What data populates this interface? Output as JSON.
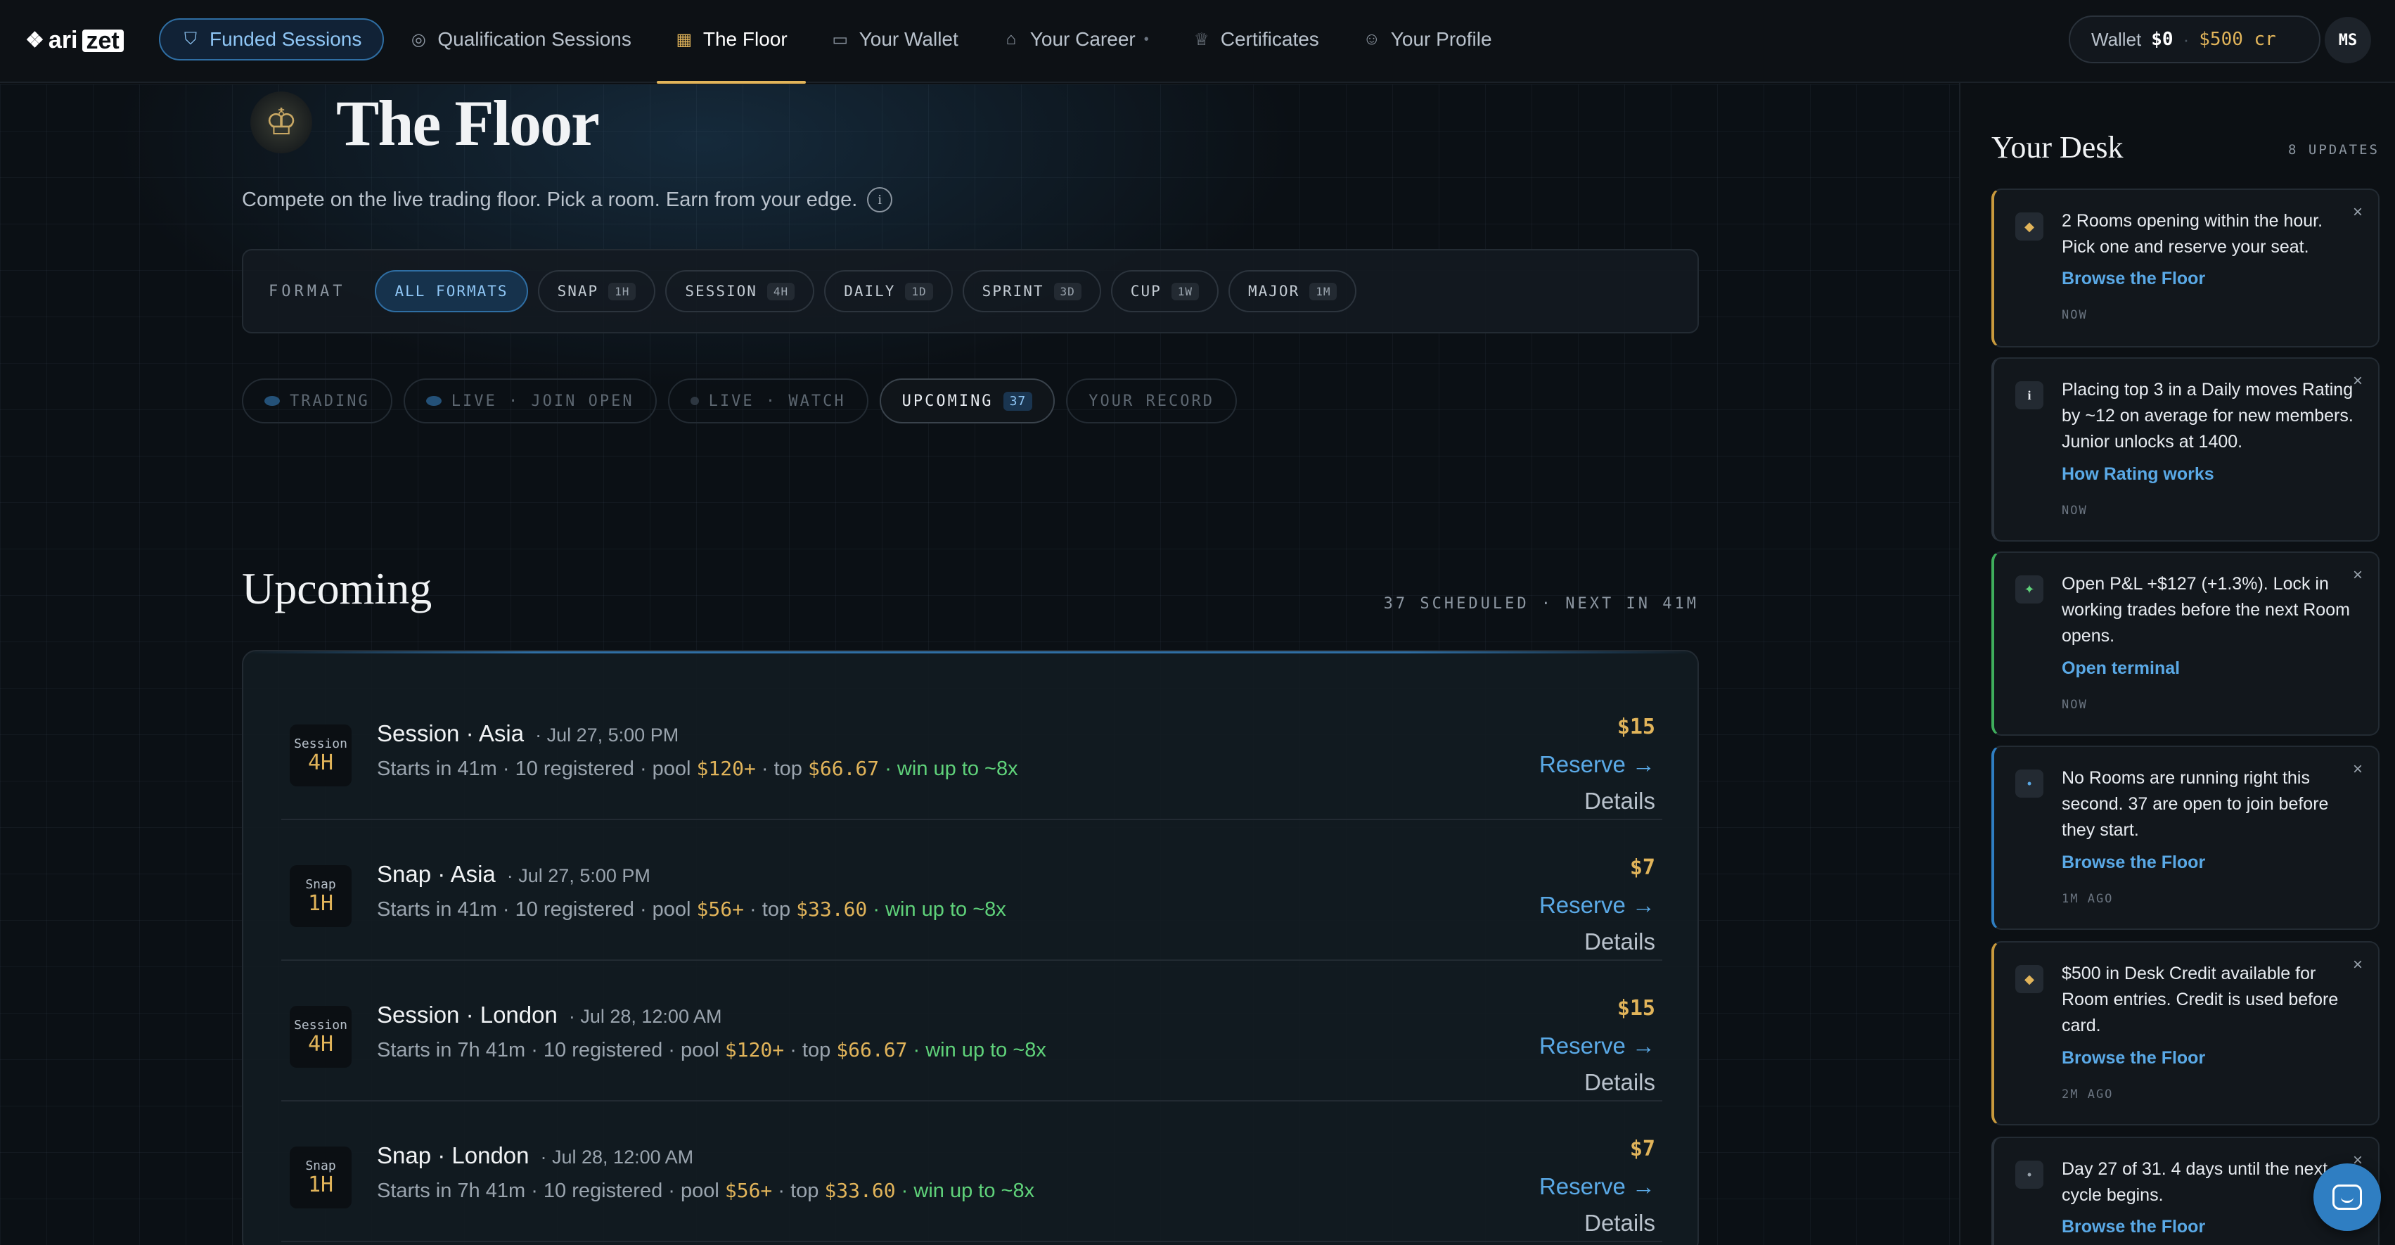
{
  "logo": {
    "brand": "ari",
    "mark": "zet"
  },
  "nav": {
    "items": [
      {
        "label": "Funded Sessions",
        "icon": "badge-icon"
      },
      {
        "label": "Qualification Sessions",
        "icon": "target-icon"
      },
      {
        "label": "The Floor",
        "icon": "grid-icon"
      },
      {
        "label": "Your Wallet",
        "icon": "wallet-icon"
      },
      {
        "label": "Your Career",
        "icon": "home-icon"
      },
      {
        "label": "Certificates",
        "icon": "trophy-icon"
      },
      {
        "label": "Your Profile",
        "icon": "user-icon"
      }
    ],
    "active": "The Floor"
  },
  "wallet": {
    "label": "Wallet",
    "cash": "$0",
    "credit": "$500 cr"
  },
  "avatar": {
    "initials": "MS"
  },
  "hero": {
    "title": "The Floor",
    "subtitle": "Compete on the live trading floor. Pick a room. Earn from your edge."
  },
  "formats": {
    "label": "FORMAT",
    "items": [
      {
        "label": "ALL FORMATS",
        "badge": ""
      },
      {
        "label": "SNAP",
        "badge": "1H"
      },
      {
        "label": "SESSION",
        "badge": "4H"
      },
      {
        "label": "DAILY",
        "badge": "1D"
      },
      {
        "label": "SPRINT",
        "badge": "3D"
      },
      {
        "label": "CUP",
        "badge": "1W"
      },
      {
        "label": "MAJOR",
        "badge": "1M"
      }
    ]
  },
  "statuses": [
    {
      "label": "TRADING"
    },
    {
      "label": "LIVE · JOIN OPEN"
    },
    {
      "label": "LIVE · WATCH"
    },
    {
      "label": "UPCOMING",
      "count": "37"
    },
    {
      "label": "YOUR RECORD"
    }
  ],
  "upcoming": {
    "title": "Upcoming",
    "meta": "37 SCHEDULED · NEXT IN 41M",
    "rows": [
      {
        "tile_top": "Session",
        "tile_bottom": "4H",
        "name": "Session · Asia",
        "date": "· Jul 27, 5:00 PM",
        "starts": "Starts in 41m · 10 registered · pool ",
        "pool": "$120+",
        "top_label": " · top ",
        "top": "$66.67",
        "win": " · win up to ~8x",
        "price": "$15",
        "reserve": "Reserve →",
        "details": "Details"
      },
      {
        "tile_top": "Snap",
        "tile_bottom": "1H",
        "name": "Snap · Asia",
        "date": "· Jul 27, 5:00 PM",
        "starts": "Starts in 41m · 10 registered · pool ",
        "pool": "$56+",
        "top_label": " · top ",
        "top": "$33.60",
        "win": " · win up to ~8x",
        "price": "$7",
        "reserve": "Reserve →",
        "details": "Details"
      },
      {
        "tile_top": "Session",
        "tile_bottom": "4H",
        "name": "Session · London",
        "date": "· Jul 28, 12:00 AM",
        "starts": "Starts in 7h 41m · 10 registered · pool ",
        "pool": "$120+",
        "top_label": " · top ",
        "top": "$66.67",
        "win": " · win up to ~8x",
        "price": "$15",
        "reserve": "Reserve →",
        "details": "Details"
      },
      {
        "tile_top": "Snap",
        "tile_bottom": "1H",
        "name": "Snap · London",
        "date": "· Jul 28, 12:00 AM",
        "starts": "Starts in 7h 41m · 10 registered · pool ",
        "pool": "$56+",
        "top_label": " · top ",
        "top": "$33.60",
        "win": " · win up to ~8x",
        "price": "$7",
        "reserve": "Reserve →",
        "details": "Details"
      }
    ]
  },
  "desk": {
    "title": "Your Desk",
    "count": "8 UPDATES",
    "cards": [
      {
        "icon": "◆",
        "icon_color": "#e1b45a",
        "text": "2 Rooms opening within the hour. Pick one and reserve your seat.",
        "link": "Browse the Floor",
        "time": "NOW"
      },
      {
        "icon": "i",
        "icon_color": "#e8ecf1",
        "text": "Placing top 3 in a Daily moves Rating by ~12 on average for new members. Junior unlocks at 1400.",
        "link": "How Rating works",
        "time": "NOW"
      },
      {
        "icon": "✦",
        "icon_color": "#5fd27a",
        "text": "Open P&L +$127 (+1.3%). Lock in working trades before the next Room opens.",
        "link": "Open terminal",
        "time": "NOW"
      },
      {
        "icon": "•",
        "icon_color": "#5aa9e6",
        "text": "No Rooms are running right this second. 37 are open to join before they start.",
        "link": "Browse the Floor",
        "time": "1M AGO"
      },
      {
        "icon": "◆",
        "icon_color": "#e1b45a",
        "text": "$500 in Desk Credit available for Room entries. Credit is used before card.",
        "link": "Browse the Floor",
        "time": "2M AGO"
      },
      {
        "icon": "•",
        "icon_color": "#9aa4ae",
        "text": "Day 27 of 31. 4 days until the next cycle begins.",
        "link": "Browse the Floor",
        "time": ""
      }
    ],
    "close": "×"
  }
}
